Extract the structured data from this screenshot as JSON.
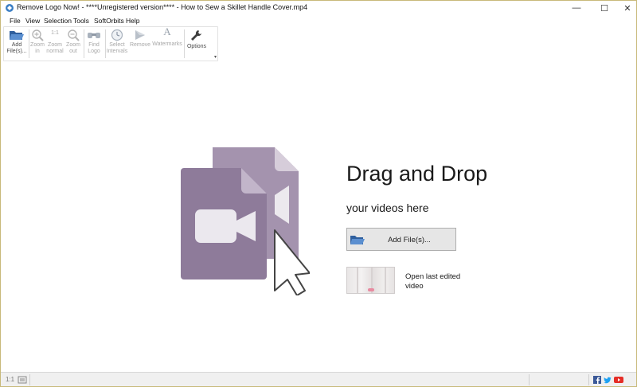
{
  "window": {
    "title": "Remove Logo Now! - ****Unregistered version**** - How to Sew a Skillet Handle Cover.mp4",
    "controls": {
      "minimize": "—",
      "maximize": "☐",
      "close": "✕"
    }
  },
  "menu": {
    "items": [
      "File",
      "View",
      "Selection",
      "Tools",
      "SoftOrbits",
      "Help"
    ]
  },
  "toolbar": {
    "buttons": [
      {
        "line1": "Add",
        "line2": "File(s)...",
        "icon": "folder-open-icon",
        "enabled": true
      },
      {
        "line1": "Zoom",
        "line2": "in",
        "icon": "zoom-in-icon",
        "enabled": false
      },
      {
        "line1": "Zoom",
        "line2": "normal",
        "icon": "zoom-normal-icon",
        "enabled": false,
        "glyph": "1:1"
      },
      {
        "line1": "Zoom",
        "line2": "out",
        "icon": "zoom-out-icon",
        "enabled": false
      },
      {
        "line1": "Find",
        "line2": "Logo",
        "icon": "binoculars-icon",
        "enabled": false
      },
      {
        "line1": "Select",
        "line2": "Intervals",
        "icon": "clock-icon",
        "enabled": false
      },
      {
        "line1": "Remove",
        "line2": "",
        "icon": "play-arrow-icon",
        "enabled": false
      },
      {
        "line1": "Watermarks",
        "line2": "",
        "icon": "letter-a-icon",
        "enabled": false,
        "glyph": "A"
      },
      {
        "line1": "Options",
        "line2": "",
        "icon": "wrench-icon",
        "enabled": true
      }
    ],
    "more": "▾"
  },
  "main": {
    "drag_title": "Drag and Drop",
    "drag_subtitle": "your videos here",
    "add_button_label": "Add File(s)...",
    "last_edited_label_line1": "Open last edited",
    "last_edited_label_line2": "video"
  },
  "statusbar": {
    "zoom": "1:1",
    "social": [
      "facebook-icon",
      "twitter-icon",
      "youtube-icon"
    ]
  },
  "colors": {
    "accent_purple": "#8e7b9a",
    "accent_purple_light": "#a493ae",
    "folder_blue": "#4a78b8"
  }
}
